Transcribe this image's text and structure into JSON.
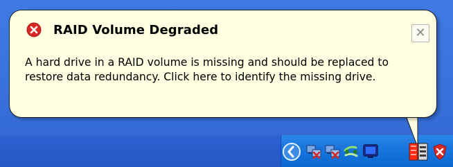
{
  "balloon": {
    "title": "RAID Volume Degraded",
    "message": "A hard drive in a RAID volume is missing and should be replaced to restore data redundancy. Click here to identify the missing drive.",
    "close_glyph": "✕",
    "title_icon": "error-icon"
  },
  "tray": {
    "icons": [
      "show-hidden-icons-icon",
      "network-disconnected-icon",
      "network-disconnected-icon",
      "connection-icon",
      "display-icon",
      "raid-storage-icon",
      "security-alert-icon"
    ]
  },
  "colors": {
    "balloon_bg": "#ffffe1",
    "taskbar": "#2456c3",
    "tray": "#0b68cf",
    "error_red": "#d82a24"
  }
}
